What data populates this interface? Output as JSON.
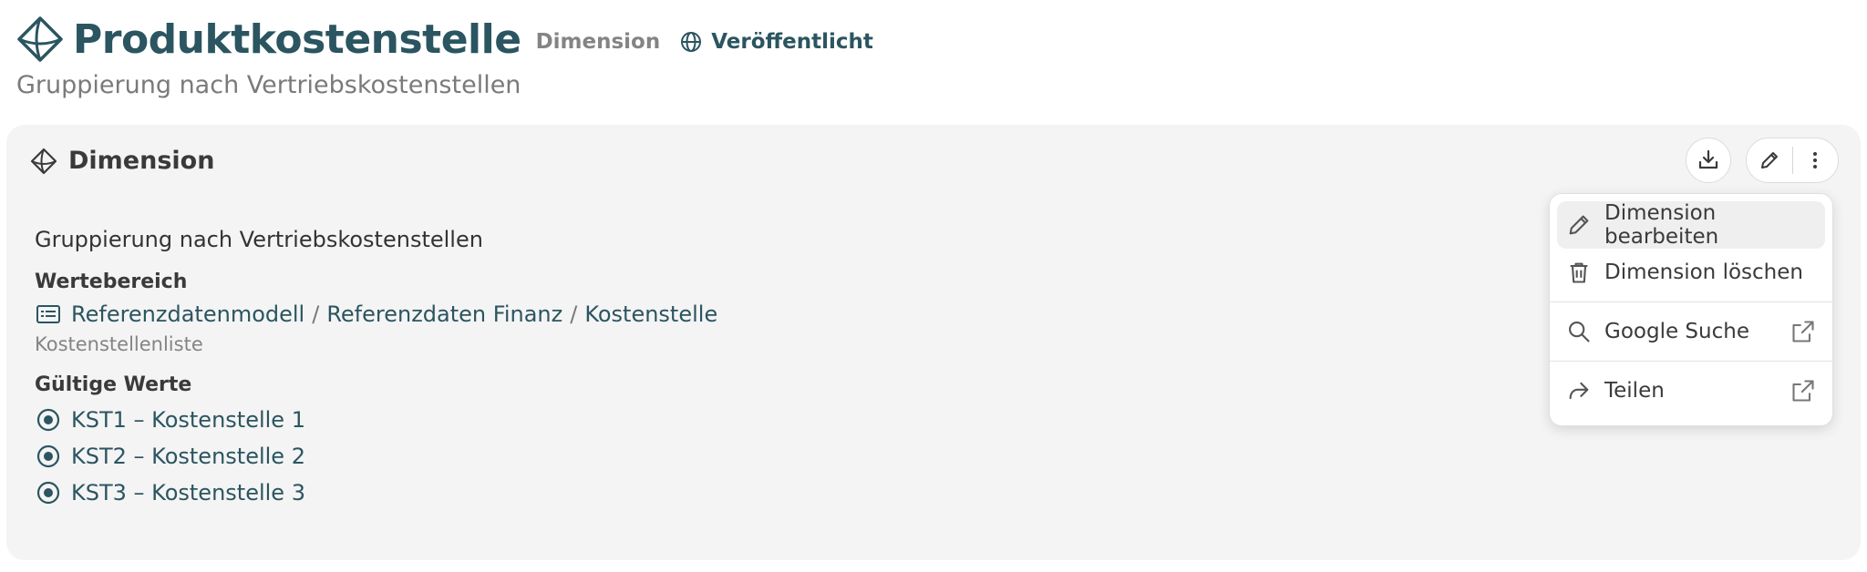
{
  "header": {
    "title": "Produktkostenstelle",
    "kind": "Dimension",
    "status": "Veröffentlicht",
    "subtitle": "Gruppierung nach Vertriebskostenstellen",
    "icon": "diamond-icon"
  },
  "card": {
    "title": "Dimension",
    "description": "Gruppierung nach Vertriebskostenstellen",
    "range_label": "Wertebereich",
    "range_path": [
      "Referenzdatenmodell",
      "Referenzdaten Finanz",
      "Kostenstelle"
    ],
    "range_separator": "/",
    "range_note": "Kostenstellenliste",
    "values_label": "Gültige Werte",
    "values": [
      "KST1 – Kostenstelle 1",
      "KST2 – Kostenstelle 2",
      "KST3 – Kostenstelle 3"
    ]
  },
  "menu": {
    "items": [
      {
        "label": "Dimension bearbeiten",
        "icon": "pencil-icon"
      },
      {
        "label": "Dimension löschen",
        "icon": "trash-icon"
      },
      {
        "label": "Google Suche",
        "icon": "search-icon"
      },
      {
        "label": "Teilen",
        "icon": "share-icon"
      }
    ]
  },
  "colors": {
    "accent": "#2b5560",
    "muted": "#848484",
    "card_bg": "#f4f4f4"
  }
}
